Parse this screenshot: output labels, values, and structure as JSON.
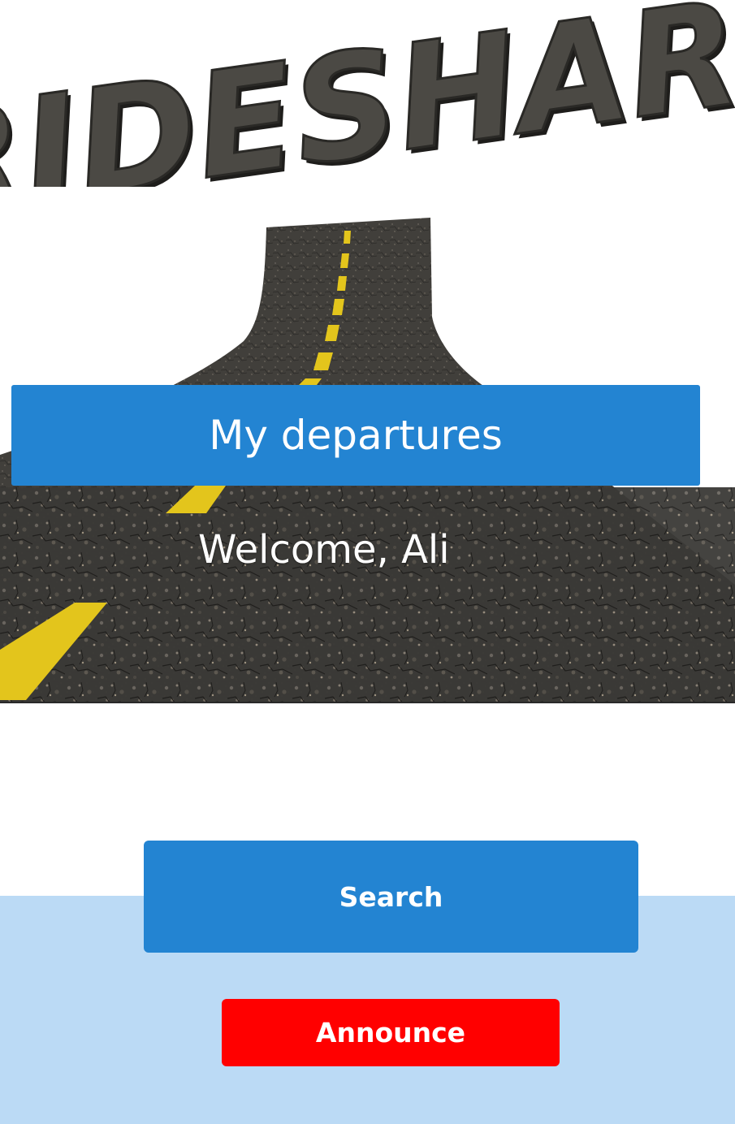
{
  "hero": {
    "brand_text": "RIDESHARE",
    "image_name": "asphalt-road-illustration"
  },
  "header": {
    "departures_label": "My departures",
    "welcome_text": "Welcome, Ali"
  },
  "actions": {
    "search_label": "Search",
    "announce_label": "Announce"
  },
  "colors": {
    "primary_blue": "#2384d2",
    "announce_red": "#ff0000",
    "panel_light_blue": "#bbdaf5"
  }
}
